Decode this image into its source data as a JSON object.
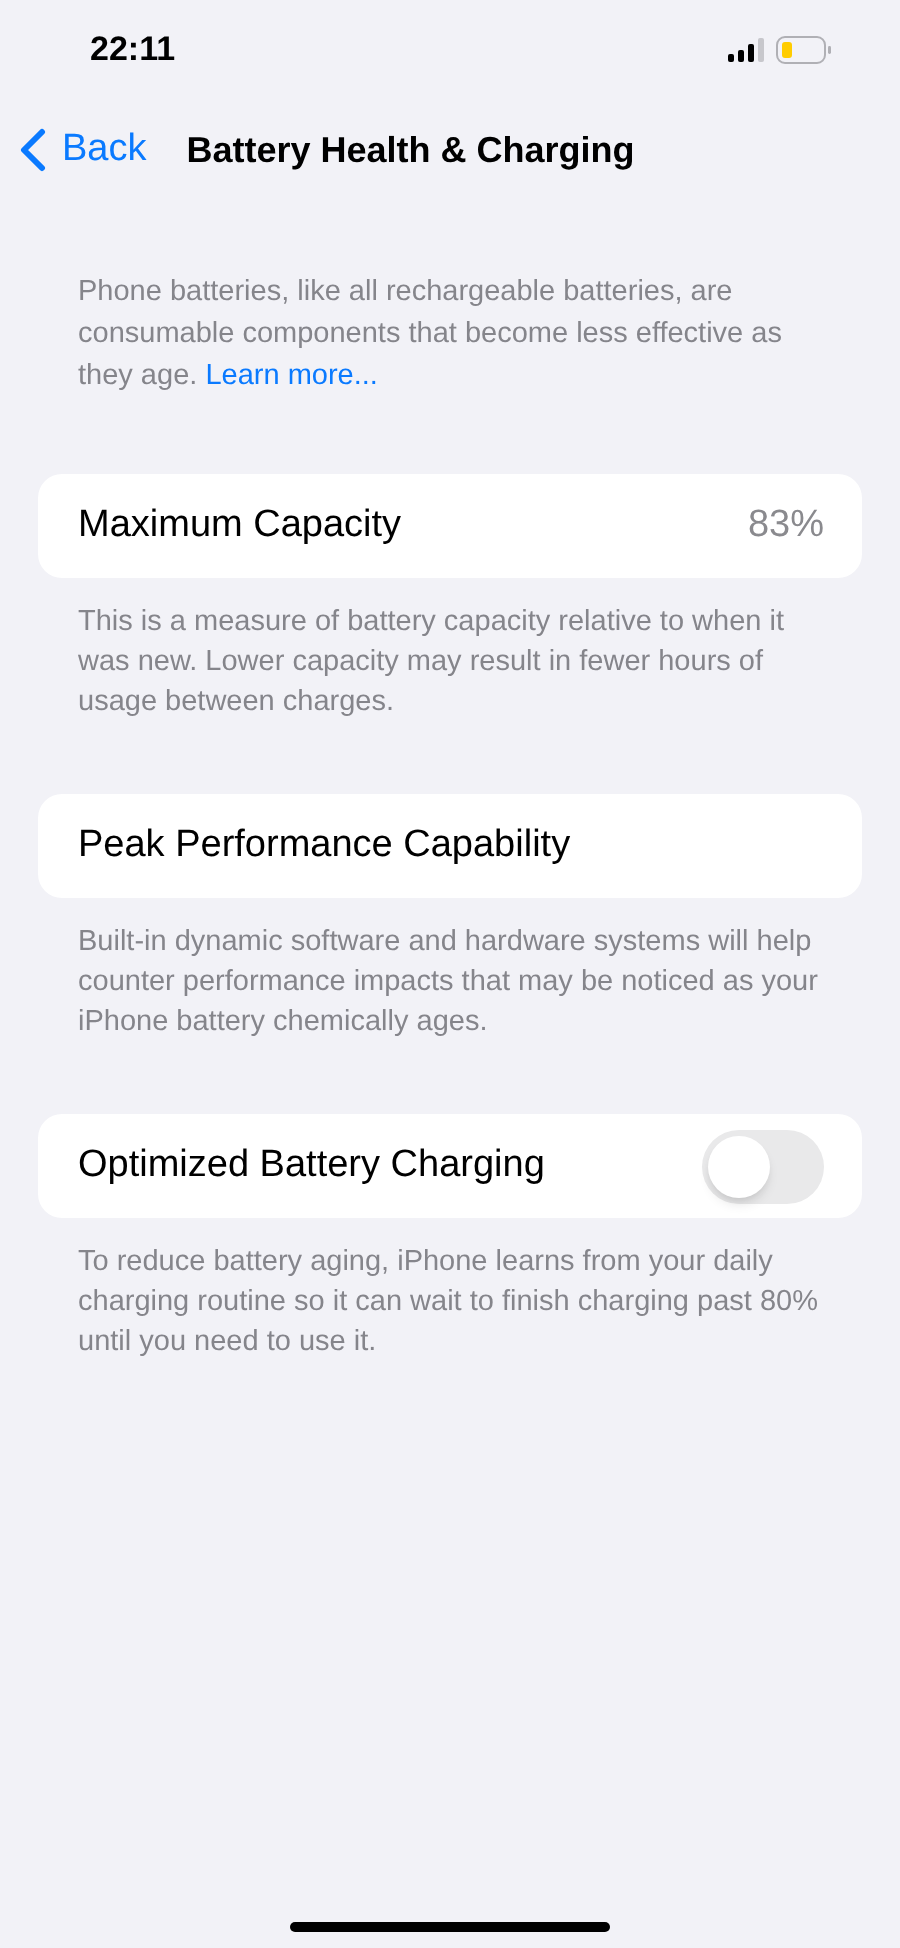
{
  "status_bar": {
    "time": "22:11"
  },
  "nav": {
    "back": "Back",
    "title": "Battery Health & Charging"
  },
  "intro": {
    "text": "Phone batteries, like all rechargeable batteries, are consumable components that become less effective as they age.",
    "link": "Learn more..."
  },
  "sections": [
    {
      "kind": "value",
      "label": "Maximum Capacity",
      "value": "83%",
      "note": "This is a measure of battery capacity relative to when it was new. Lower capacity may result in fewer hours of usage between charges."
    },
    {
      "kind": "plain",
      "label": "Peak Performance Capability",
      "note": "Built-in dynamic software and hardware systems will help counter performance impacts that may be noticed as your iPhone battery chemically ages."
    },
    {
      "kind": "toggle",
      "label": "Optimized Battery Charging",
      "on": false,
      "note": "To reduce battery aging, iPhone learns from your daily charging routine so it can wait to finish charging past 80% until you need to use it."
    }
  ]
}
